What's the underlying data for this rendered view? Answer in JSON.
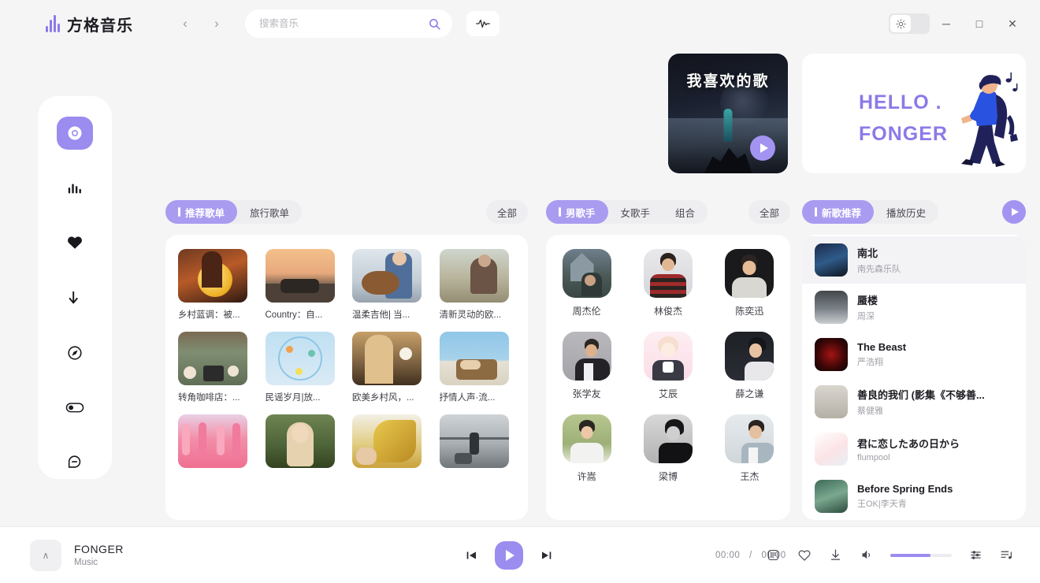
{
  "app": {
    "title": "方格音乐",
    "accent": "#9b8cf0",
    "background": "#f5f5f6"
  },
  "topbar": {
    "back_label": "‹",
    "forward_label": "›",
    "search": {
      "value": "",
      "placeholder": "搜索音乐"
    },
    "wave_button": "wave-icon",
    "window": {
      "minimize": "─",
      "maximize": "□",
      "close": "✕"
    }
  },
  "sidebar": {
    "items": [
      {
        "name": "sidebar-item-home",
        "icon": "disc-icon",
        "active": true
      },
      {
        "name": "sidebar-item-ranking",
        "icon": "bar-chart-icon",
        "active": false
      },
      {
        "name": "sidebar-item-favorites",
        "icon": "heart-icon",
        "active": false
      },
      {
        "name": "sidebar-item-downloads",
        "icon": "download-arrow-icon",
        "active": false
      },
      {
        "name": "sidebar-item-discover",
        "icon": "compass-icon",
        "active": false
      },
      {
        "name": "sidebar-item-settings",
        "icon": "toggle-icon",
        "active": false
      },
      {
        "name": "sidebar-item-messages",
        "icon": "chat-bubble-icon",
        "active": false
      }
    ]
  },
  "hero": {
    "dark_card": {
      "title": "我喜欢的歌",
      "play_button": "play-icon"
    },
    "white_card": {
      "line1": "HELLO .",
      "line2": "FONGER"
    }
  },
  "playlists": {
    "tabs": [
      {
        "label": "推荐歌单",
        "active": true
      },
      {
        "label": "旅行歌单",
        "active": false
      }
    ],
    "all_label": "全部",
    "items": [
      {
        "name": "乡村蓝调：被...",
        "img": "moon-lantern"
      },
      {
        "name": "Country：自...",
        "img": "road-trip"
      },
      {
        "name": "温柔吉他| 当...",
        "img": "guitar-girl"
      },
      {
        "name": "清新灵动的欧...",
        "img": "field-woman"
      },
      {
        "name": "转角咖啡店：...",
        "img": "cafe-table"
      },
      {
        "name": "民谣岁月|放...",
        "img": "ferris-wheel"
      },
      {
        "name": "欧美乡村风，...",
        "img": "flower-girl"
      },
      {
        "name": "抒情人声·流...",
        "img": "beach-chair"
      },
      {
        "name": "",
        "img": "flamingos"
      },
      {
        "name": "",
        "img": "blonde-woman"
      },
      {
        "name": "",
        "img": "wheat"
      },
      {
        "name": "",
        "img": "street-musician"
      }
    ]
  },
  "singers": {
    "tabs": [
      {
        "label": "男歌手",
        "active": true
      },
      {
        "label": "女歌手",
        "active": false
      },
      {
        "label": "组合",
        "active": false
      }
    ],
    "all_label": "全部",
    "items": [
      {
        "name": "周杰伦",
        "img": "castle-portrait"
      },
      {
        "name": "林俊杰",
        "img": "red-sweater"
      },
      {
        "name": "陈奕迅",
        "img": "grey-shirt-dark"
      },
      {
        "name": "张学友",
        "img": "black-suit-grey"
      },
      {
        "name": "艾辰",
        "img": "anime-pink"
      },
      {
        "name": "薛之谦",
        "img": "dark-portrait"
      },
      {
        "name": "许嵩",
        "img": "white-coat-green"
      },
      {
        "name": "梁博",
        "img": "bw-portrait"
      },
      {
        "name": "王杰",
        "img": "light-blue-shirt"
      }
    ]
  },
  "newsongs": {
    "tabs": [
      {
        "label": "新歌推荐",
        "active": true
      },
      {
        "label": "播放历史",
        "active": false
      }
    ],
    "play_all": "play-icon",
    "items": [
      {
        "title": "南北",
        "artist": "南先森乐队",
        "cover": "blue-dark",
        "selected": true
      },
      {
        "title": "蜃楼",
        "artist": "周深",
        "cover": "grey-object",
        "selected": false
      },
      {
        "title": "The Beast",
        "artist": "严浩翔",
        "cover": "red-black",
        "selected": false
      },
      {
        "title": "善良的我们 (影集《不够善...",
        "artist": "蔡健雅",
        "cover": "pale-figures",
        "selected": false
      },
      {
        "title": "君に恋したあの日から",
        "artist": "flumpool",
        "cover": "white-pink",
        "selected": false
      },
      {
        "title": "Before Spring Ends",
        "artist": "王OK|李天青",
        "cover": "green-teal",
        "selected": false
      }
    ]
  },
  "player": {
    "expand_label": "∧",
    "track": "FONGER",
    "subtitle": "Music",
    "prev": "previous-icon",
    "play": "play-icon",
    "next": "next-icon",
    "time_current": "00:00",
    "time_separator": "/",
    "time_total": "00:00",
    "volume_percent": 65,
    "right_icons": [
      "lyrics-icon",
      "heart-icon",
      "download-icon",
      "volume-icon",
      "equalizer-icon",
      "playlist-icon"
    ]
  }
}
